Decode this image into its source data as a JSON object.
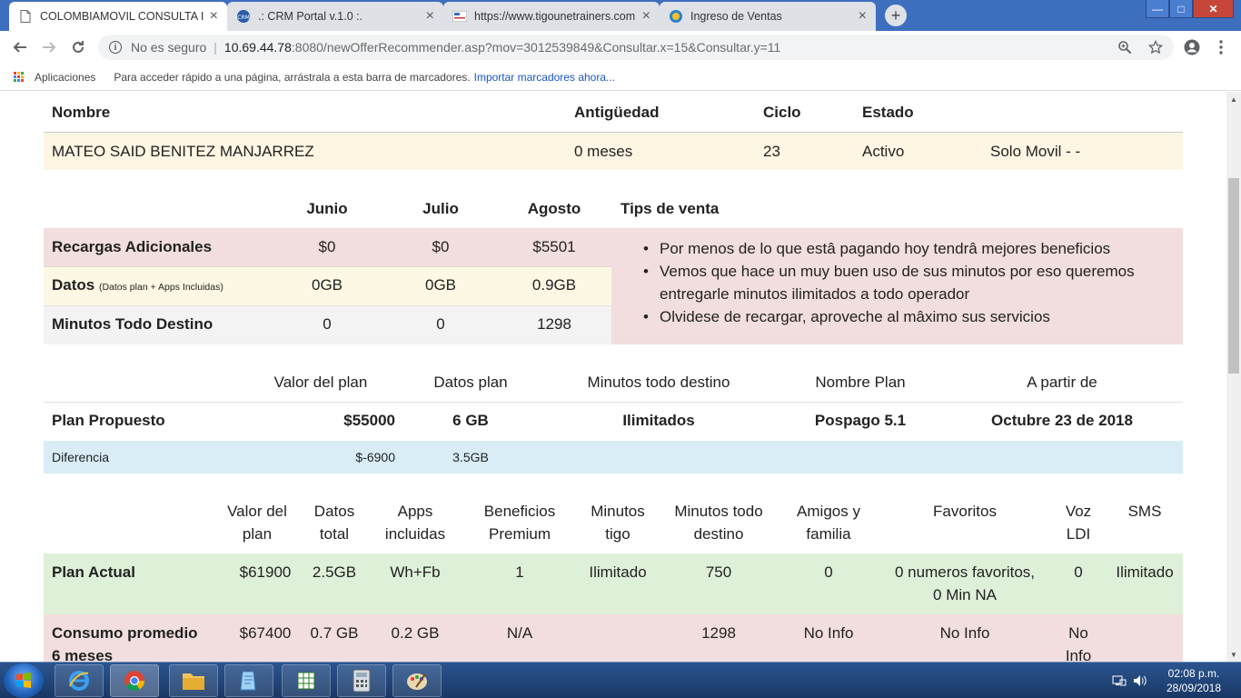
{
  "browser": {
    "tabs": [
      {
        "title": "COLOMBIAMOVIL CONSULTA IN",
        "active": true
      },
      {
        "title": ".: CRM Portal v.1.0 :.",
        "active": false
      },
      {
        "title": "https://www.tigounetrainers.com",
        "active": false
      },
      {
        "title": "Ingreso de Ventas",
        "active": false
      }
    ],
    "new_tab": "+",
    "window_controls": {
      "minimize": "—",
      "maximize": "□",
      "close": "✕"
    },
    "address": {
      "security": "No es seguro",
      "separator": "|",
      "host": "10.69.44.78",
      "rest": ":8080/newOfferRecommender.asp?mov=3012539849&Consultar.x=15&Consultar.y=11"
    },
    "bookmarks": {
      "apps": "Aplicaciones",
      "hint": "Para acceder rápido a una página, arrástrala a esta barra de marcadores.",
      "import_link": "Importar marcadores ahora..."
    }
  },
  "client": {
    "headers": {
      "name": "Nombre",
      "seniority": "Antigüedad",
      "cycle": "Ciclo",
      "status": "Estado"
    },
    "name": "MATEO SAID BENITEZ MANJARREZ",
    "seniority": "0 meses",
    "cycle": "23",
    "status": "Activo",
    "line_type": "Solo Movil - -"
  },
  "usage": {
    "months": [
      "Junio",
      "Julio",
      "Agosto"
    ],
    "tips_header": "Tips de venta",
    "rows": [
      {
        "label": "Recargas Adicionales",
        "note": "",
        "values": [
          "$0",
          "$0",
          "$5501"
        ]
      },
      {
        "label": "Datos",
        "note": "(Datos plan + Apps Incluidas)",
        "values": [
          "0GB",
          "0GB",
          "0.9GB"
        ]
      },
      {
        "label": "Minutos Todo Destino",
        "note": "",
        "values": [
          "0",
          "0",
          "1298"
        ]
      }
    ],
    "tips": [
      "Por menos de lo que estâ pagando hoy tendrâ mejores beneficios",
      "Vemos que hace un muy buen uso de sus minutos por eso queremos entregarle minutos ilimitados a todo operador",
      "Olvidese de recargar, aproveche al mâximo sus servicios"
    ]
  },
  "proposal": {
    "headers": [
      "Valor del plan",
      "Datos plan",
      "Minutos todo destino",
      "Nombre Plan",
      "A partir de"
    ],
    "label": "Plan Propuesto",
    "value": "$55000",
    "data": "6 GB",
    "minutes": "Ilimitados",
    "plan_name": "Pospago 5.1",
    "start": "Octubre 23 de 2018",
    "diff_label": "Diferencia",
    "diff_value": "$-6900",
    "diff_data": "3.5GB"
  },
  "current": {
    "headers": [
      [
        "Valor del",
        "plan"
      ],
      [
        "Datos",
        "total"
      ],
      [
        "Apps",
        "incluidas"
      ],
      [
        "Beneficios",
        "Premium"
      ],
      [
        "Minutos",
        "tigo"
      ],
      [
        "Minutos todo",
        "destino"
      ],
      [
        "Amigos y",
        "familia"
      ],
      [
        "Favoritos",
        ""
      ],
      [
        "Voz",
        "LDI"
      ],
      [
        "SMS",
        ""
      ]
    ],
    "plan_actual": {
      "label": "Plan Actual",
      "values": [
        "$61900",
        "2.5GB",
        "Wh+Fb",
        "1",
        "Ilimitado",
        "750",
        "0",
        "0 numeros favoritos,",
        "0",
        "Ilimitado"
      ],
      "favorites_line2": "0 Min NA"
    },
    "consumo": {
      "label_line1": "Consumo promedio",
      "label_line2": "6 meses",
      "values": [
        "$67400",
        "0.7 GB",
        "0.2 GB",
        "N/A",
        "",
        "1298",
        "No Info",
        "No Info",
        "No",
        ""
      ],
      "voz_line2": "Info"
    }
  },
  "taskbar": {
    "time": "02:08 p.m.",
    "date": "28/09/2018"
  },
  "colors": {
    "titlebar": "#3d6fbe",
    "name_row_bg": "#fdf6e3",
    "recargas_bg": "#f2dede",
    "datos_bg": "#fcf8e3",
    "minutos_bg": "#f3f3f3",
    "diff_bg": "#d9edf7",
    "plan_actual_bg": "#dff0d8",
    "consumo_bg": "#f2dede"
  }
}
